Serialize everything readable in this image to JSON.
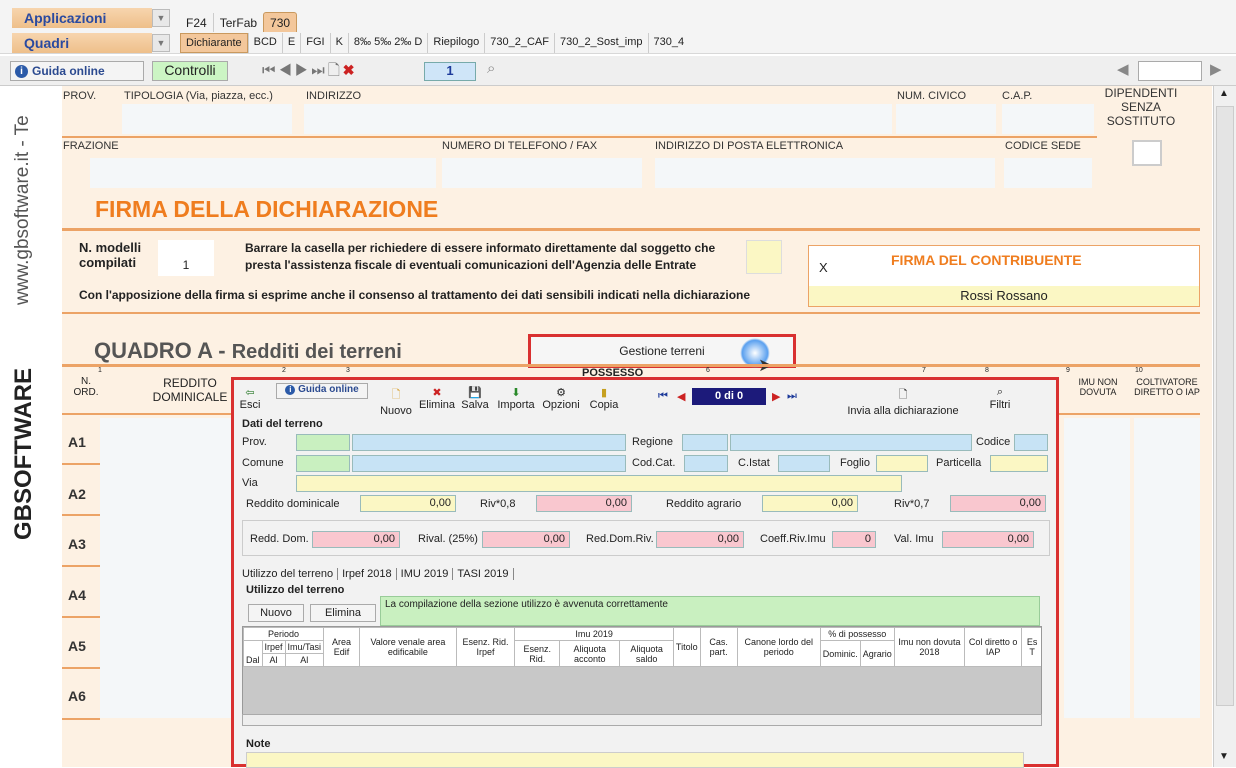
{
  "topbar": {
    "applicazioni": "Applicazioni",
    "quadri": "Quadri",
    "tabs": [
      "F24",
      "TerFab",
      "730"
    ],
    "quadri_tabs": [
      "Dichiarante",
      "BCD",
      "E",
      "FGI",
      "K",
      "8‰ 5‰ 2‰ D",
      "Riepilogo",
      "730_2_CAF",
      "730_2_Sost_imp",
      "730_4"
    ]
  },
  "navbar": {
    "guida": "Guida online",
    "controlli": "Controlli",
    "page": "1"
  },
  "sidebar": {
    "site": "www.gbsoftware.it - Te",
    "brand": "GBSOFTWARE"
  },
  "form": {
    "prov": "PROV.",
    "tipologia": "TIPOLOGIA (Via, piazza, ecc.)",
    "indirizzo": "INDIRIZZO",
    "num_civico": "NUM. CIVICO",
    "cap": "C.A.P.",
    "dipendenti": "DIPENDENTI SENZA SOSTITUTO",
    "frazione": "FRAZIONE",
    "telefono": "NUMERO DI TELEFONO / FAX",
    "email": "INDIRIZZO DI POSTA ELETTRONICA",
    "codice_sede": "CODICE SEDE",
    "firma_title": "FIRMA DELLA DICHIARAZIONE",
    "n_modelli": "N. modelli compilati",
    "n_modelli_value": "1",
    "barrare": "Barrare la casella per richiedere di essere informato direttamente dal soggetto che presta l'assistenza fiscale di eventuali comunicazioni dell'Agenzia delle Entrate",
    "consenso": "Con l'apposizione della firma si esprime anche il consenso al trattamento dei dati sensibili indicati nella dichiarazione",
    "firma_x": "X",
    "firma_contribuente": "FIRMA DEL CONTRIBUENTE",
    "firmatario": "Rossi Rossano",
    "quadro": "QUADRO A -",
    "quadro_sub": "Redditi dei terreni",
    "gestione": "Gestione terreni",
    "n_ord": "N. ORD.",
    "reddito_dominicale": "REDDITO DOMINICALE",
    "possesso": "POSSESSO",
    "imu": "IMU NON DOVUTA",
    "coltivatore": "COLTIVATORE DIRETTO O IAP",
    "col_nums": [
      "1",
      "2",
      "3",
      "6",
      "7",
      "8",
      "9",
      "10"
    ],
    "rows": [
      "A1",
      "A2",
      "A3",
      "A4",
      "A5",
      "A6"
    ]
  },
  "dialog": {
    "toolbar": [
      "Esci",
      "Nuovo",
      "Elimina",
      "Salva",
      "Importa",
      "Opzioni",
      "Copia",
      "Invia alla dichiarazione",
      "Filtri"
    ],
    "guida": "Guida online",
    "counter": "0 di 0",
    "dati": "Dati del terreno",
    "prov": "Prov.",
    "regione": "Regione",
    "codice": "Codice",
    "comune": "Comune",
    "codcat": "Cod.Cat.",
    "cistat": "C.Istat",
    "foglio": "Foglio",
    "particella": "Particella",
    "via": "Via",
    "redd_dom": "Reddito dominicale",
    "redd_dom_v": "0,00",
    "riv08": "Riv*0,8",
    "riv08_v": "0,00",
    "redd_agr": "Reddito agrario",
    "redd_agr_v": "0,00",
    "riv07": "Riv*0,7",
    "riv07_v": "0,00",
    "redd_dom2": "Redd. Dom.",
    "redd_dom2_v": "0,00",
    "rival": "Rival. (25%)",
    "rival_v": "0,00",
    "reddomriv": "Red.Dom.Riv.",
    "reddomriv_v": "0,00",
    "coeff": "Coeff.Riv.Imu",
    "coeff_v": "0",
    "valimu": "Val. Imu",
    "valimu_v": "0,00",
    "subtabs": [
      "Utilizzo del terreno",
      "Irpef 2018",
      "IMU 2019",
      "TASI 2019"
    ],
    "utilizzo": "Utilizzo del terreno",
    "nuovo": "Nuovo",
    "elimina": "Elimina",
    "msg": "La compilazione della sezione utilizzo è avvenuta correttamente",
    "grid": {
      "periodo": "Periodo",
      "irpef": "Irpef",
      "imutasi": "Imu/Tasi",
      "dal": "Dal",
      "al": "Al",
      "al2": "Al",
      "area": "Area Edif",
      "valore": "Valore venale area edificabile",
      "esenz_irpef": "Esenz. Rid. Irpef",
      "imu2019": "Imu 2019",
      "esenz_rid": "Esenz. Rid.",
      "aliq_acc": "Aliquota acconto",
      "aliq_saldo": "Aliquota saldo",
      "titolo": "Titolo",
      "cas": "Cas. part.",
      "canone": "Canone lordo del periodo",
      "perc": "% di possesso",
      "dominic": "Dominic.",
      "agrario": "Agrario",
      "imunon": "Imu non dovuta 2018",
      "col": "Col diretto o IAP",
      "es": "Es T"
    },
    "note": "Note"
  }
}
